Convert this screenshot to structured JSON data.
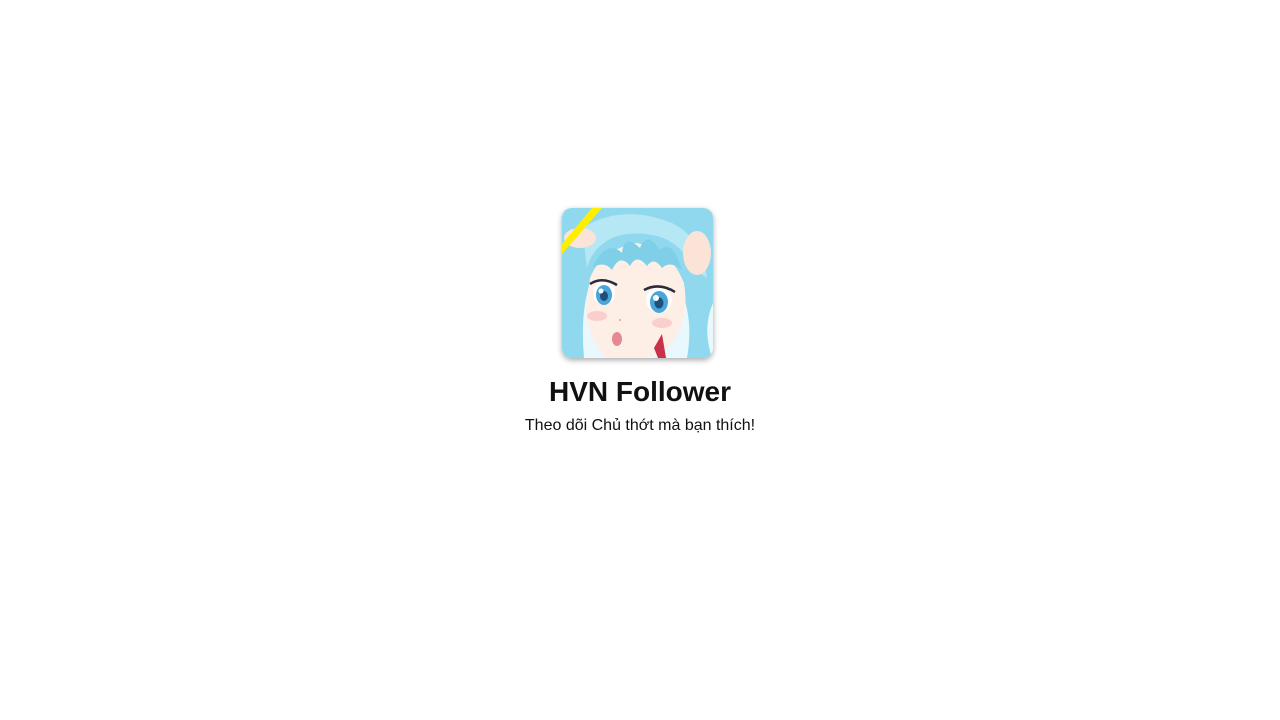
{
  "splash": {
    "logo_icon": "anime-girl-app-logo",
    "title": "HVN Follower",
    "subtitle": "Theo dõi Chủ thớt mà bạn thích!"
  },
  "colors": {
    "background": "#ffffff",
    "text": "#111111",
    "hair": "#8fd8ee",
    "accent_stripe": "#ffee00"
  }
}
